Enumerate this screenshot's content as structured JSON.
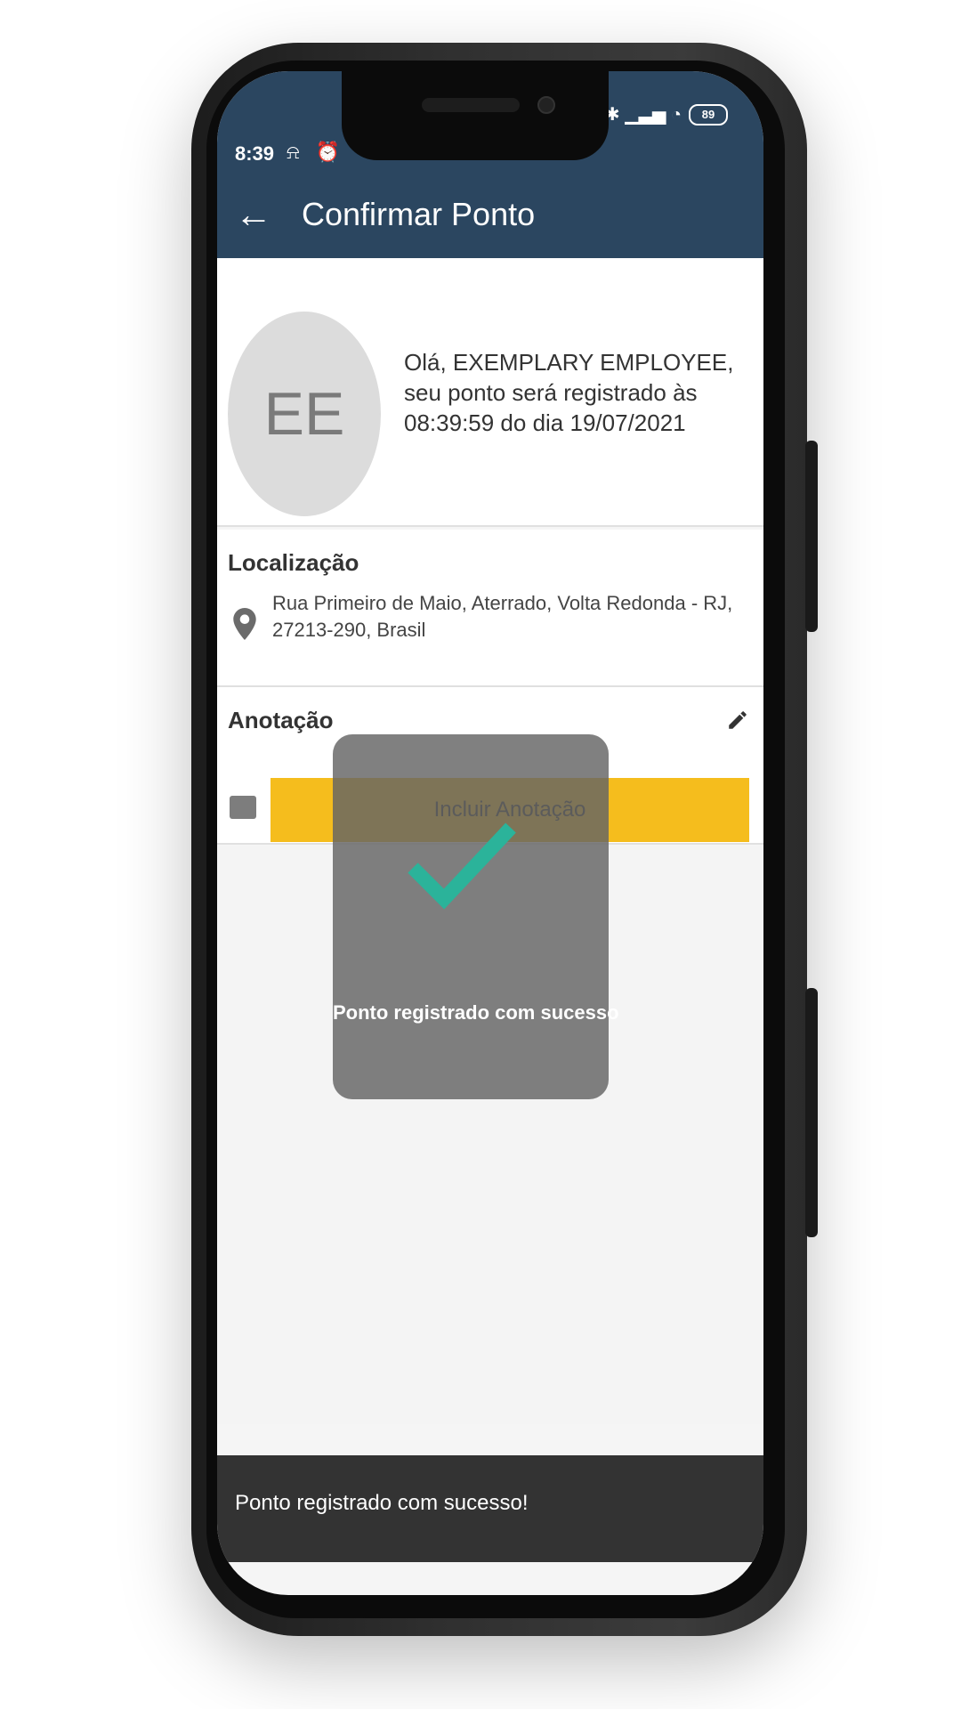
{
  "status_bar": {
    "time": "8:39",
    "left_icons": "⍾ ⏰",
    "right_icons": "✱ ▁▃▅ ◔",
    "battery": "89"
  },
  "app_bar": {
    "back_icon": "arrow-left-icon",
    "title": "Confirmar Ponto"
  },
  "employee": {
    "initials": "EE",
    "greeting": "Olá, EXEMPLARY EMPLOYEE, seu ponto será registrado às 08:39:59 do dia 19/07/2021"
  },
  "location": {
    "title": "Localização",
    "icon": "map-pin-icon",
    "address": "Rua Primeiro de Maio, Aterrado, Volta Redonda - RJ, 27213-290, Brasil"
  },
  "annotation": {
    "title": "Anotação",
    "edit_icon": "pencil-icon",
    "note_icon": "comment-icon",
    "button_label": "Incluir Anotação",
    "button_color": "#f5bd1d"
  },
  "success_dialog": {
    "icon": "checkmark-icon",
    "message": "Ponto registrado com sucesso",
    "check_color": "#2bb39a"
  },
  "snackbar": {
    "message": "Ponto registrado com sucesso!"
  },
  "colors": {
    "appbar": "#2b4660",
    "accent": "#f5bd1d"
  }
}
